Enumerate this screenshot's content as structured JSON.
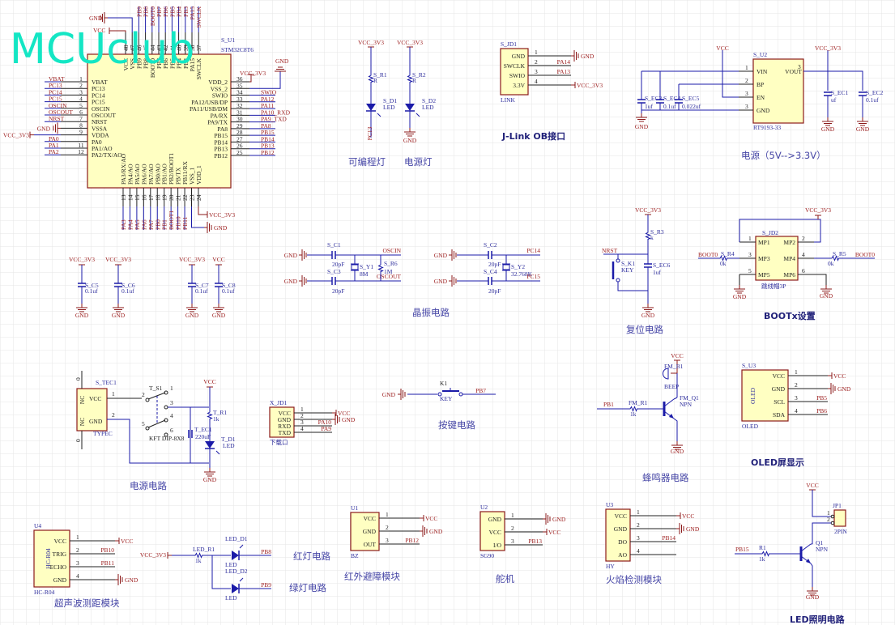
{
  "watermark": "MCUclub",
  "power_names": {
    "gnd": "GND",
    "vcc": "VCC",
    "vcc3v3": "VCC_3V3"
  },
  "mcu": {
    "ref": "S_U1",
    "part": "STM32C8T6",
    "left": [
      {
        "num": "1",
        "name": "VBAT",
        "net": "VBAT"
      },
      {
        "num": "2",
        "name": "PC13",
        "net": "PC13"
      },
      {
        "num": "3",
        "name": "PC14",
        "net": "PC14"
      },
      {
        "num": "4",
        "name": "PC15",
        "net": "PC15"
      },
      {
        "num": "5",
        "name": "OSCIN",
        "net": "OSCIN"
      },
      {
        "num": "6",
        "name": "OSCOUT",
        "net": "OSCOUT"
      },
      {
        "num": "7",
        "name": "NRST",
        "net": "NRST"
      },
      {
        "num": "8",
        "name": "VSSA",
        "net": "GND"
      },
      {
        "num": "9",
        "name": "VDDA",
        "net": "VCC_3V3"
      },
      {
        "num": "",
        "name": "PA0",
        "net": "PA0"
      },
      {
        "num": "11",
        "name": "PA1/AO",
        "net": "PA1"
      },
      {
        "num": "12",
        "name": "PA2/TX/AO",
        "net": "PA2"
      }
    ],
    "right": [
      {
        "num": "36",
        "name": "VDD_2",
        "net": "VCC_3V3"
      },
      {
        "num": "35",
        "name": "VSS_2",
        "net": "GND"
      },
      {
        "num": "34",
        "name": "SWIO",
        "net": "SWIO"
      },
      {
        "num": "33",
        "name": "PA12/USB/DP",
        "net": "PA12"
      },
      {
        "num": "32",
        "name": "PA11/USB/DM",
        "net": "PA11"
      },
      {
        "num": "31",
        "name": "PA/RX",
        "net": "PA10_RXD"
      },
      {
        "num": "30",
        "name": "PA9/TX",
        "net": "PA9_TXD"
      },
      {
        "num": "29",
        "name": "PA8",
        "net": "PA8"
      },
      {
        "num": "28",
        "name": "PB15",
        "net": "PB15"
      },
      {
        "num": "27",
        "name": "PB14",
        "net": "PB14"
      },
      {
        "num": "26",
        "name": "PB13",
        "net": "PB13"
      },
      {
        "num": "25",
        "name": "PB12",
        "net": "PB12"
      }
    ],
    "top": [
      {
        "num": "48",
        "name": "VCC",
        "net": "VCC"
      },
      {
        "num": "47",
        "name": "VSS",
        "net": "GND"
      },
      {
        "num": "46",
        "name": "PB9",
        "net": "PB9"
      },
      {
        "num": "45",
        "name": "PB8",
        "net": "PB8"
      },
      {
        "num": "44",
        "name": "BOOT0",
        "net": "BOOT0"
      },
      {
        "num": "43",
        "name": "PB7",
        "net": "PB7"
      },
      {
        "num": "42",
        "name": "PB6",
        "net": "PB6"
      },
      {
        "num": "41",
        "name": "PB5",
        "net": "PB5"
      },
      {
        "num": "40",
        "name": "PB4",
        "net": "PB4"
      },
      {
        "num": "39",
        "name": "PB3",
        "net": "PB3"
      },
      {
        "num": "38",
        "name": "PA15",
        "net": "PA15"
      },
      {
        "num": "37",
        "name": "SWCLK",
        "net": "SWCLK"
      }
    ],
    "bottom": [
      {
        "num": "13",
        "name": "PA3/RX/AO",
        "net": "PA3"
      },
      {
        "num": "14",
        "name": "PA4/AO",
        "net": "PA4"
      },
      {
        "num": "15",
        "name": "PA5/AO",
        "net": "PA5"
      },
      {
        "num": "16",
        "name": "PA6/AO",
        "net": "PA6"
      },
      {
        "num": "17",
        "name": "PA7/AO",
        "net": "PA7"
      },
      {
        "num": "18",
        "name": "PB0/AO",
        "net": "PB0"
      },
      {
        "num": "19",
        "name": "PB1/AO",
        "net": "PB1"
      },
      {
        "num": "20",
        "name": "PB2/BOOT1",
        "net": "BOOT1"
      },
      {
        "num": "21",
        "name": "PB/TX",
        "net": "PB10"
      },
      {
        "num": "22",
        "name": "PB11/RX",
        "net": "PB11"
      },
      {
        "num": "23",
        "name": "VSS_1",
        "net": "GND"
      },
      {
        "num": "24",
        "name": "VDD_1",
        "net": "VCC_3V3"
      }
    ]
  },
  "decoupling": [
    {
      "ref": "S_C5",
      "val": "0.1uf",
      "pwr": "VCC_3V3",
      "gnd": "GND"
    },
    {
      "ref": "S_C6",
      "val": "0.1uf",
      "pwr": "VCC_3V3",
      "gnd": "GND"
    },
    {
      "ref": "S_C7",
      "val": "0.1uf",
      "pwr": "VCC_3V3",
      "gnd": "GND"
    },
    {
      "ref": "S_C8",
      "val": "0.1uf",
      "pwr": "VCC",
      "gnd": "GND"
    }
  ],
  "indicator": {
    "title_prog": "可编程灯",
    "title_power": "电源灯",
    "r1_ref": "S_R1",
    "r1_val": "R",
    "r2_ref": "S_R2",
    "r2_val": "R",
    "d1_ref": "S_D1",
    "d1_val": "LED",
    "d2_ref": "S_D2",
    "d2_val": "LED",
    "net": "PC13",
    "vcc": "VCC_3V3",
    "gnd": "GND"
  },
  "jlink": {
    "ref": "S_JD1",
    "footer": "LINK",
    "title": "J-Link OB接口",
    "pins": [
      {
        "num": "1",
        "name": "GND",
        "net": "GND"
      },
      {
        "num": "2",
        "name": "SWCLK",
        "net": "PA14"
      },
      {
        "num": "3",
        "name": "SWIO",
        "net": "PA13"
      },
      {
        "num": "4",
        "name": "3.3V",
        "net": "VCC_3V3"
      }
    ]
  },
  "regulator": {
    "ref": "S_U2",
    "part": "RT9193-33",
    "title": "电源（5V-->3.3V）",
    "pins": [
      {
        "num": "1",
        "name": "VIN"
      },
      {
        "num": "2",
        "name": "BP"
      },
      {
        "num": "3",
        "name": "EN"
      },
      {
        "num": "3",
        "name": "GND"
      }
    ],
    "vout_name": "VOUT",
    "vout_num": "3",
    "vin": "VCC",
    "vout": "VCC_3V3",
    "gnd": "GND",
    "caps": [
      {
        "ref": "S_EC3",
        "val": "1uf"
      },
      {
        "ref": "S_EC4",
        "val": "0.1uf"
      },
      {
        "ref": "S_EC5",
        "val": "0.022uf"
      },
      {
        "ref": "S_EC1",
        "val": "uf"
      },
      {
        "ref": "S_EC2",
        "val": "0.1uf"
      }
    ]
  },
  "crystal": {
    "title": "晶振电路",
    "gnd": "GND",
    "c1": {
      "ref": "S_C1",
      "val": "20pF"
    },
    "c3": {
      "ref": "S_C3",
      "val": "20pF"
    },
    "y1": {
      "ref": "S_Y1",
      "val": "8M"
    },
    "r6": {
      "ref": "S_R6",
      "val": "1M"
    },
    "osc_in": "OSCIN",
    "osc_out": "OSCOUT",
    "c2": {
      "ref": "S_C2",
      "val": "20pF"
    },
    "c4": {
      "ref": "S_C4",
      "val": "20pF"
    },
    "y2": {
      "ref": "S_Y2",
      "val": "32.768K"
    },
    "pc14": "PC14",
    "pc15": "PC15"
  },
  "reset": {
    "title": "复位电路",
    "vcc": "VCC_3V3",
    "r3_ref": "S_R3",
    "r3_val": "k",
    "nrst": "NRST",
    "k1_ref": "S_K1",
    "k1_val": "KEY",
    "ec6_ref": "S_EC6",
    "ec6_val": "1uf",
    "gnd": "GND"
  },
  "boot": {
    "title": "BOOTx设置",
    "ref": "S_JD2",
    "part": "跳线帽3P",
    "vcc": "VCC_3V3",
    "gnd": "GND",
    "pins": [
      {
        "num": "1",
        "name": "MP1"
      },
      {
        "num": "2",
        "name": "MP2"
      },
      {
        "num": "3",
        "name": "MP3"
      },
      {
        "num": "4",
        "name": "MP4"
      },
      {
        "num": "5",
        "name": "MP5"
      },
      {
        "num": "6",
        "name": "MP6"
      }
    ],
    "r4": {
      "ref": "S_R4",
      "val": "0k"
    },
    "r5": {
      "ref": "S_R5",
      "val": "0k"
    },
    "boot0": "BOOT0"
  },
  "power_circuit": {
    "title": "电源电路",
    "ref": "S_TEC1",
    "part": "TYPEC",
    "pins": [
      {
        "num": "1",
        "name": "VCC"
      },
      {
        "num": "2",
        "name": "GND"
      }
    ],
    "nc": "NC",
    "zero": "0",
    "sw_ref": "T_S1",
    "sw_part": "KFT DIP-8X8",
    "sw_pins": [
      "1",
      "2",
      "3",
      "4",
      "5",
      "6"
    ],
    "vcc": "VCC",
    "r1_ref": "T_R1",
    "r1_val": "1k",
    "ec1_ref": "T_EC1",
    "ec1_val": "220uF",
    "d1_ref": "T_D1",
    "d1_val": "LED",
    "gnd": "GND"
  },
  "download": {
    "ref": "X_JD1",
    "footer": "下载口",
    "pins": [
      {
        "num": "1",
        "name": "VCC",
        "net": "VCC"
      },
      {
        "num": "2",
        "name": "GND",
        "net": "GND"
      },
      {
        "num": "3",
        "name": "RXD",
        "net": "PA10"
      },
      {
        "num": "4",
        "name": "TXD",
        "net": "PA9"
      }
    ]
  },
  "button": {
    "title": "按键电路",
    "ref": "K1",
    "val": "KEY",
    "gnd": "GND",
    "net": "PB7"
  },
  "buzzer": {
    "title": "蜂鸣器电路",
    "vcc": "VCC",
    "b1_ref": "FM_B1",
    "b1_val": "BEEP",
    "q1_ref": "FM_Q1",
    "q1_val": "NPN",
    "net": "PB1",
    "r1_ref": "FM_R1",
    "r1_val": "1k",
    "gnd": "GND"
  },
  "oled": {
    "title": "OLED屏显示",
    "ref": "S_U3",
    "inner": "OLED",
    "footer": "OLED",
    "pins": [
      {
        "num": "1",
        "name": "VCC",
        "net": "VCC"
      },
      {
        "num": "2",
        "name": "GND",
        "net": "GND"
      },
      {
        "num": "3",
        "name": "SCL",
        "net": "PB5"
      },
      {
        "num": "4",
        "name": "SDA",
        "net": "PB6"
      }
    ]
  },
  "ultrasonic": {
    "title": "超声波测距模块",
    "ref": "U4",
    "inner": "HC-R04",
    "footer": "HC-R04",
    "pins": [
      {
        "num": "1",
        "name": "VCC",
        "net": "VCC"
      },
      {
        "num": "2",
        "name": "TRIG",
        "net": "PB10"
      },
      {
        "num": "3",
        "name": "ECHO",
        "net": "PB11"
      },
      {
        "num": "4",
        "name": "GND",
        "net": "GND"
      }
    ]
  },
  "leds": {
    "title_red": "红灯电路",
    "title_green": "绿灯电路",
    "vcc": "VCC_3V3",
    "r1_ref": "LED_R1",
    "r1_val": "1k",
    "d1_ref": "LED_D1",
    "d1_val": "LED",
    "net1": "PB8",
    "d2_ref": "LED_D2",
    "d2_val": "LED",
    "net2": "PB9"
  },
  "infrared": {
    "title": "红外避障模块",
    "ref": "U1",
    "footer": "BZ",
    "pins": [
      {
        "num": "1",
        "name": "VCC",
        "net": "VCC"
      },
      {
        "num": "2",
        "name": "GND",
        "net": "GND"
      },
      {
        "num": "3",
        "name": "OUT",
        "net": "PB12"
      }
    ]
  },
  "servo": {
    "title": "舵机",
    "ref": "U2",
    "footer": "SG90",
    "pins": [
      {
        "num": "1",
        "name": "GND",
        "net": "GND"
      },
      {
        "num": "2",
        "name": "VCC",
        "net": "VCC"
      },
      {
        "num": "3",
        "name": "I/O",
        "net": "PB13"
      }
    ]
  },
  "flame": {
    "title": "火焰检测模块",
    "ref": "U3",
    "footer": "HY",
    "pins": [
      {
        "num": "1",
        "name": "VCC",
        "net": "VCC"
      },
      {
        "num": "2",
        "name": "GND",
        "net": "GND"
      },
      {
        "num": "3",
        "name": "DO",
        "net": "PB14"
      },
      {
        "num": "4",
        "name": "AO",
        "net": ""
      }
    ]
  },
  "led_light": {
    "title": "LED照明电路",
    "vcc": "VCC",
    "jp_ref": "JP1",
    "jp_val": "2PIN",
    "jp_pins": [
      "1",
      "2"
    ],
    "q1_ref": "Q1",
    "q1_val": "NPN",
    "r1_ref": "R1",
    "r1_val": "1k",
    "net": "PB15",
    "gnd": "GND"
  },
  "colors": {
    "wire": "#1b1ba8",
    "net": "#9b1b1b",
    "body": "#ffffc2",
    "outline": "#8b1a1a",
    "watermark": "#14e6c4"
  }
}
